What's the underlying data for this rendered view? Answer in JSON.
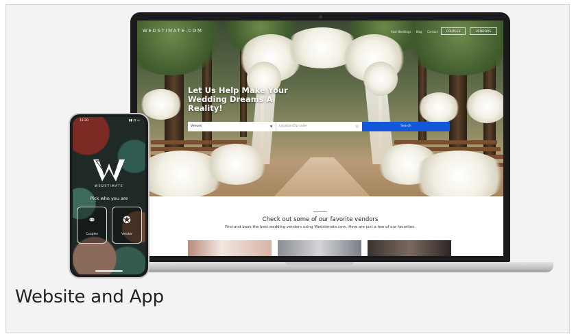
{
  "caption": "Website and App",
  "website": {
    "brand": "WEDSTIMATE.COM",
    "nav_links": [
      "Real Weddings",
      "Blog",
      "Contact"
    ],
    "couples_button": "COUPLES",
    "vendors_button": "VENDORS",
    "headline": "Let Us Help Make Your Wedding Dreams A Reality!",
    "search": {
      "venue_value": "Venues",
      "location_placeholder": "Location/Zip code",
      "button": "Search"
    },
    "favorites_title": "Check out some of our favorite vendors",
    "favorites_subtitle": "Find and book the best wedding vendors using Wedstimate.com. Here are just a few of our favorites."
  },
  "app": {
    "status_time": "11:20",
    "status_icons": "▮▮ ◔ ▭",
    "app_name": "WEDSTIMATE",
    "pick_prompt": "Pick who you are",
    "choices": [
      {
        "label": "Couples",
        "icon": "rings-icon"
      },
      {
        "label": "Vendor",
        "icon": "award-ribbon-icon"
      }
    ]
  },
  "colors": {
    "accent": "#1457d8",
    "frame_bg": "#f3f3f3"
  }
}
